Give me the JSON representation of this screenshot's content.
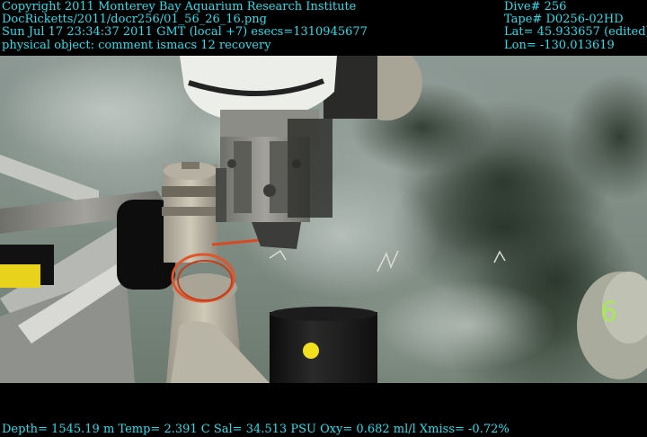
{
  "overlay": {
    "top_left": [
      "Copyright 2011 Monterey Bay Aquarium Research Institute",
      "DocRicketts/2011/docr256/01_56_26_16.png",
      "Sun Jul 17 23:34:37 2011 GMT (local +7)  esecs=1310945677",
      "physical object: comment ismacs 12 recovery"
    ],
    "top_right": [
      "Dive# 256",
      "Tape# D0256-02HD",
      "Lat= 45.933657 (edited)",
      "Lon= -130.013619"
    ],
    "bottom": "Depth= 1545.19 m  Temp= 2.391 C  Sal= 34.513 PSU  Oxy= 0.682 ml/l  Xmiss= -0.72%"
  },
  "scene": {
    "marker_label": "6"
  },
  "colors": {
    "overlay_text": "#22e0ee",
    "seafloor": "#8c9893",
    "orange_loop": "#e0552a",
    "yellow_dot": "#f2e020"
  }
}
